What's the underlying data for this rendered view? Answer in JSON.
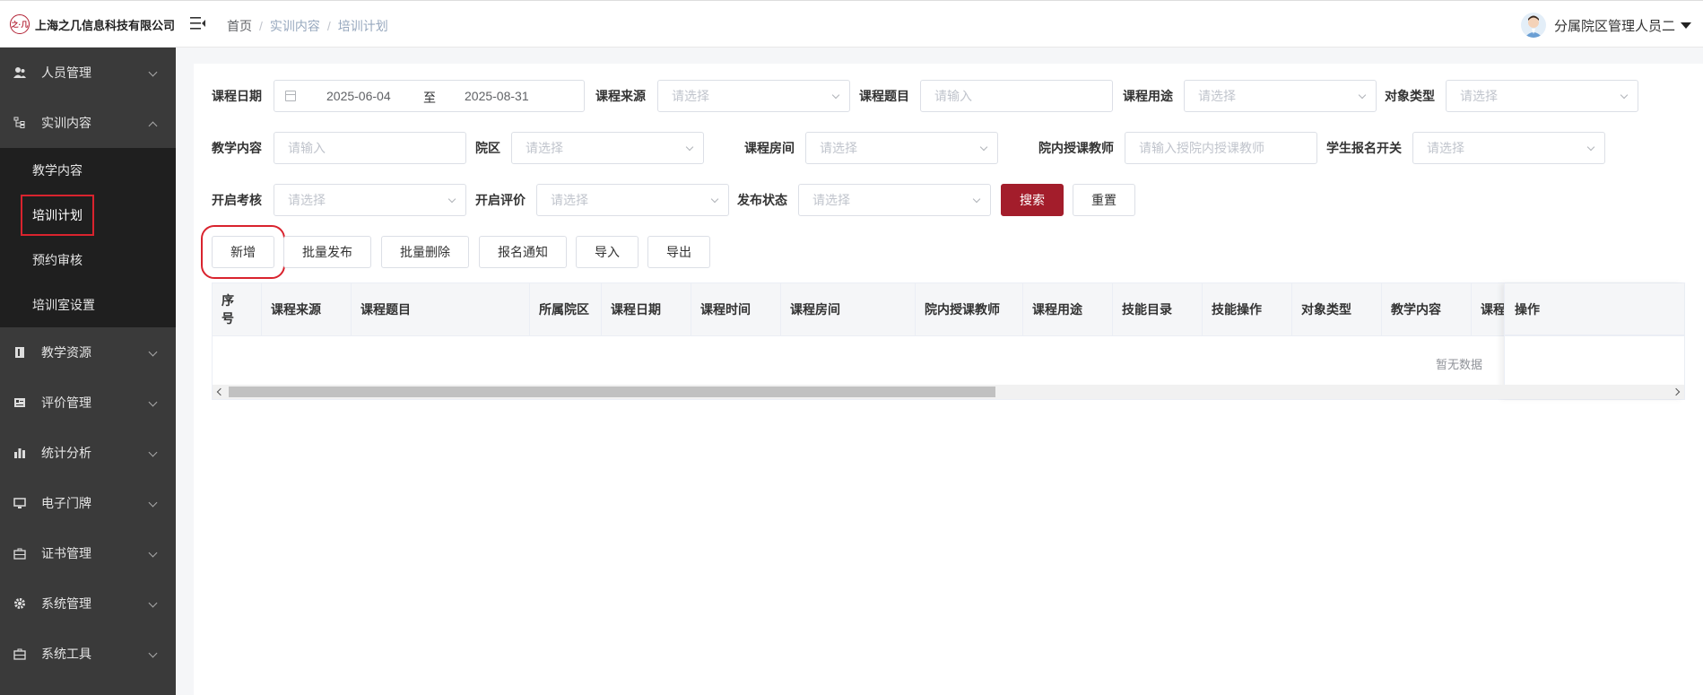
{
  "header": {
    "logo_mark": "之·几",
    "company": "上海之几信息科技有限公司",
    "breadcrumb": [
      "首页",
      "实训内容",
      "培训计划"
    ],
    "user_name": "分属院区管理人员二"
  },
  "sidebar": {
    "items": [
      {
        "label": "人员管理",
        "icon": "people-icon"
      },
      {
        "label": "实训内容",
        "icon": "tree-icon",
        "expanded": true
      },
      {
        "label": "教学资源",
        "icon": "book-icon"
      },
      {
        "label": "评价管理",
        "icon": "rating-icon"
      },
      {
        "label": "统计分析",
        "icon": "bar-chart-icon"
      },
      {
        "label": "电子门牌",
        "icon": "monitor-icon"
      },
      {
        "label": "证书管理",
        "icon": "briefcase-icon"
      },
      {
        "label": "系统管理",
        "icon": "gear-icon"
      },
      {
        "label": "系统工具",
        "icon": "toolbox-icon"
      }
    ],
    "submenu": [
      "教学内容",
      "培训计划",
      "预约审核",
      "培训室设置"
    ],
    "active_submenu": "培训计划"
  },
  "filters": {
    "course_date_label": "课程日期",
    "date_start": "2025-06-04",
    "date_to": "至",
    "date_end": "2025-08-31",
    "course_source_label": "课程来源",
    "course_topic_label": "课程题目",
    "course_purpose_label": "课程用途",
    "target_type_label": "对象类型",
    "teaching_content_label": "教学内容",
    "campus_label": "院区",
    "room_label": "课程房间",
    "teacher_label": "院内授课教师",
    "signup_switch_label": "学生报名开关",
    "exam_label": "开启考核",
    "evaluation_label": "开启评价",
    "publish_label": "发布状态",
    "placeholder_select": "请选择",
    "placeholder_input": "请输入",
    "placeholder_teacher": "请输入授院内授课教师",
    "search": "搜索",
    "reset": "重置"
  },
  "toolbar": {
    "add": "新增",
    "batch_publish": "批量发布",
    "batch_delete": "批量删除",
    "signup_notice": "报名通知",
    "import": "导入",
    "export": "导出"
  },
  "table": {
    "columns": [
      "序号",
      "课程来源",
      "课程题目",
      "所属院区",
      "课程日期",
      "课程时间",
      "课程房间",
      "院内授课教师",
      "课程用途",
      "技能目录",
      "技能操作",
      "对象类型",
      "教学内容",
      "课程"
    ],
    "ops_header": "操作",
    "empty_text": "暂无数据"
  },
  "colors": {
    "primary": "#a31d2b",
    "sidebar_bg": "#3a3a3a",
    "submenu_bg": "#1f1f1f",
    "highlight": "#d9232e"
  }
}
